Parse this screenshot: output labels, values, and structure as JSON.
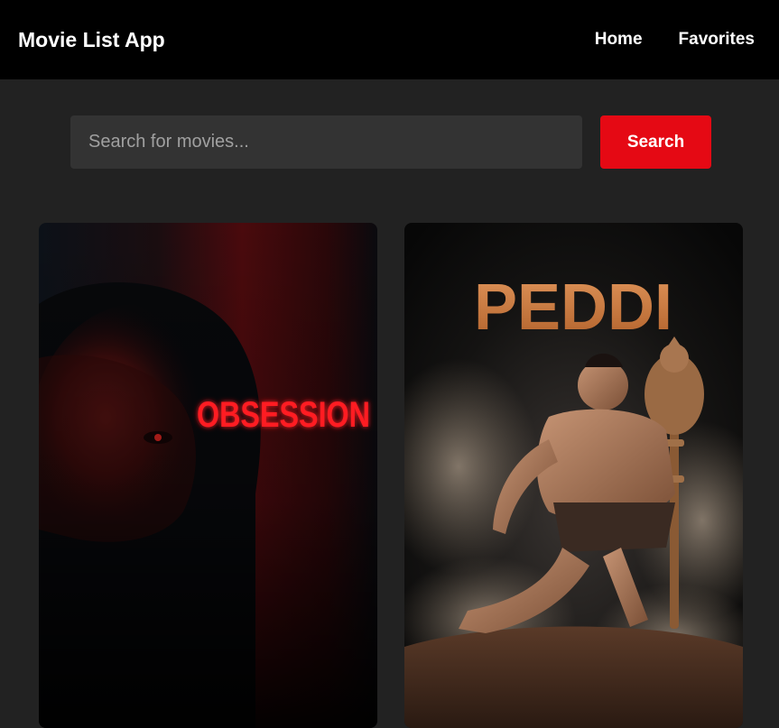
{
  "app": {
    "title": "Movie List App"
  },
  "nav": {
    "home": "Home",
    "favorites": "Favorites"
  },
  "search": {
    "placeholder": "Search for movies...",
    "button_label": "Search"
  },
  "movies": [
    {
      "poster_title": "OBSESSION",
      "accent": "#e0141e"
    },
    {
      "poster_title": "PEDDI",
      "accent": "#d9883f"
    }
  ]
}
